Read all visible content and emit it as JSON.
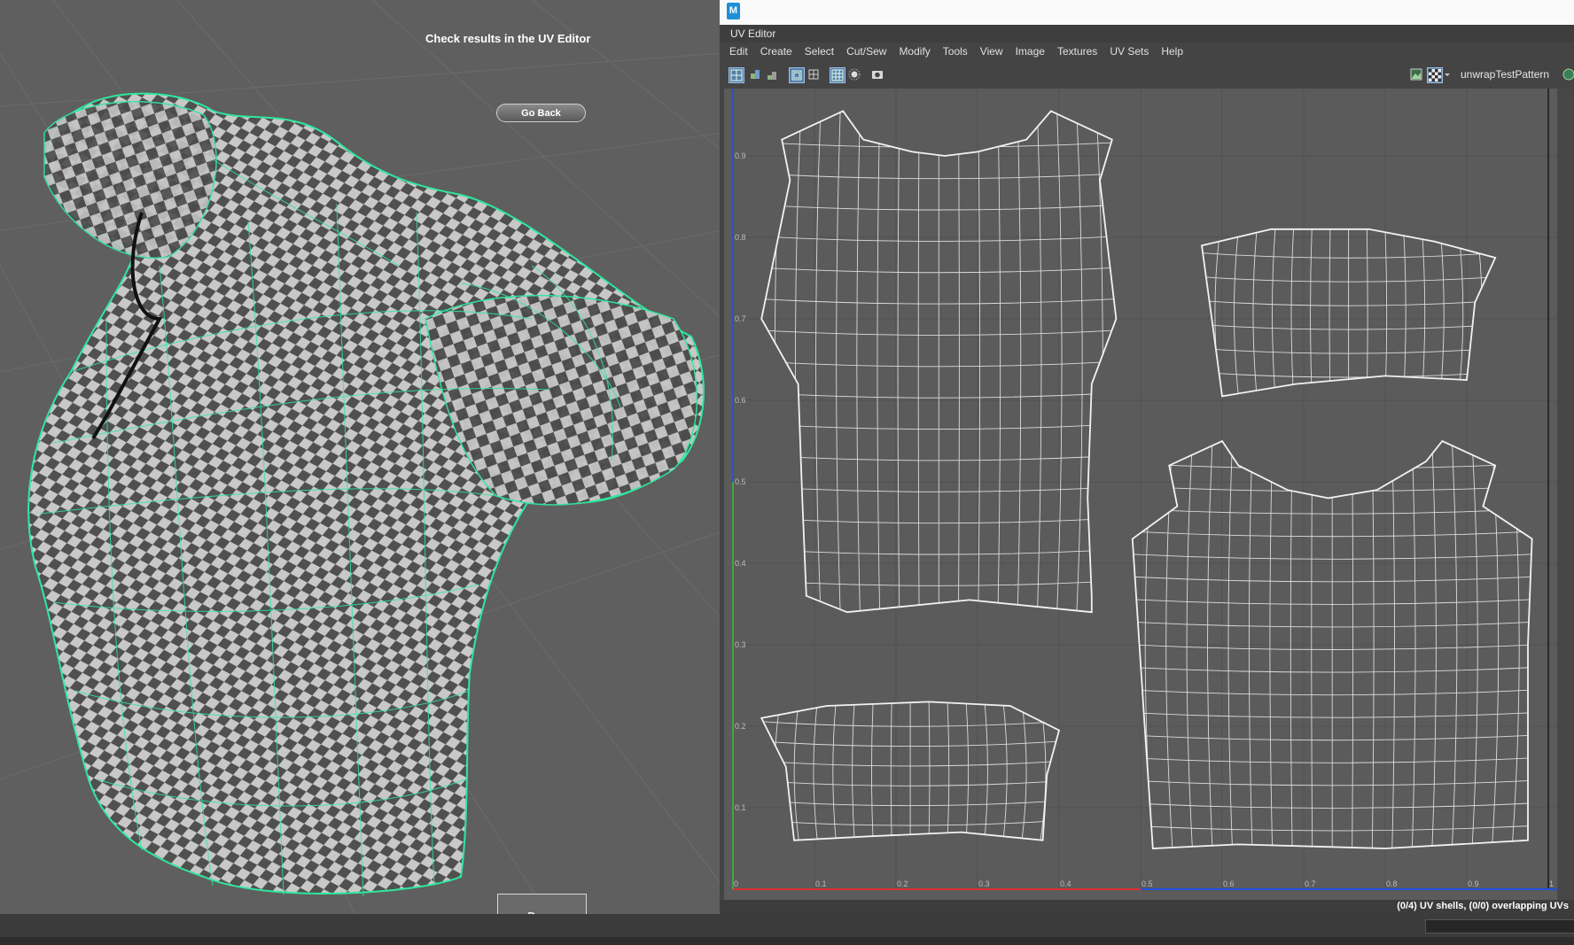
{
  "viewport": {
    "hint": "Check results in the UV Editor",
    "go_back_label": "Go Back",
    "done_label": "Done"
  },
  "uv_editor": {
    "app_icon_label": "M",
    "panel_title": "UV Editor",
    "menu": [
      "Edit",
      "Create",
      "Select",
      "Cut/Sew",
      "Modify",
      "Tools",
      "View",
      "Image",
      "Textures",
      "UV Sets",
      "Help"
    ],
    "texture_name": "unwrapTestPattern",
    "v_ticks": [
      "0.9",
      "0.8",
      "0.7",
      "0.6",
      "0.5",
      "0.4",
      "0.3",
      "0.2",
      "0.1"
    ],
    "u_ticks": [
      "0",
      "0.1",
      "0.2",
      "0.3",
      "0.4",
      "0.5",
      "0.6",
      "0.7",
      "0.8",
      "0.9",
      "1"
    ],
    "status": "(0/4) UV shells, (0/0) overlapping UVs"
  },
  "colors": {
    "wireframe_green": "#2ee8a0",
    "u_axis": "#e03030",
    "v_axis": "#2050e0",
    "uv_lines": "#f2f2f2"
  }
}
